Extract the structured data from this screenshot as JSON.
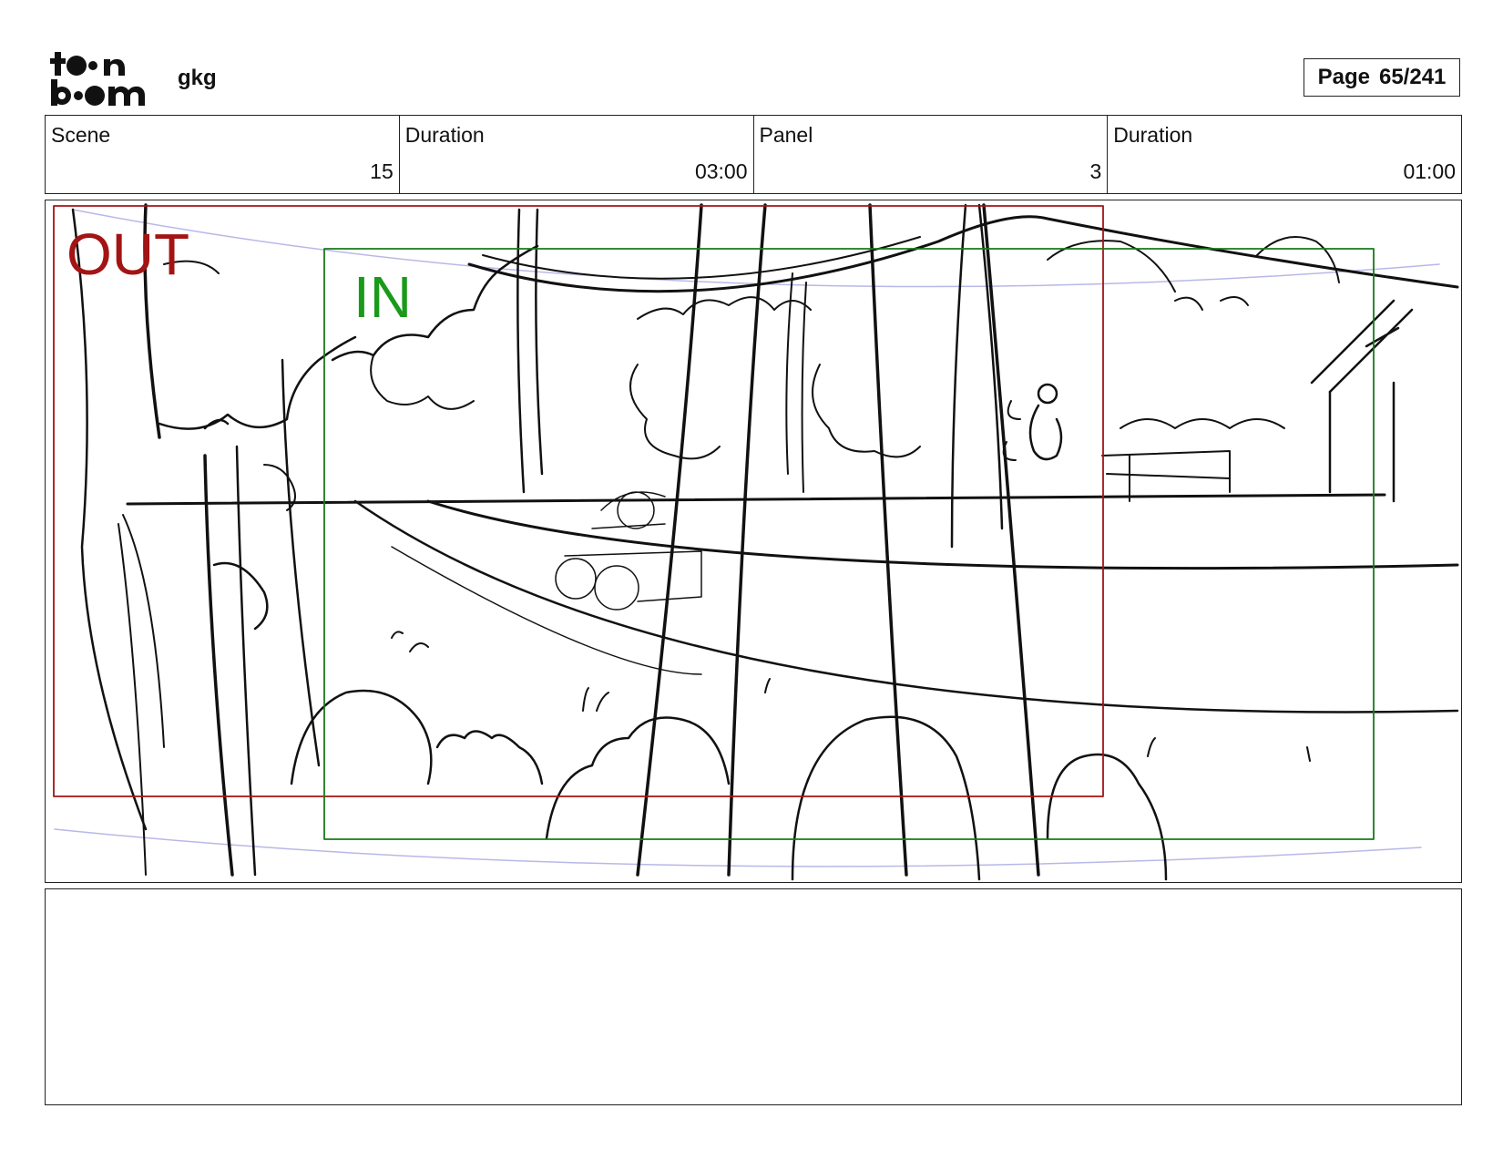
{
  "header": {
    "logo_text_top": "toon",
    "logo_text_bottom": "boom",
    "project_name": "gkg",
    "page_label": "Page",
    "page_value": "65/241"
  },
  "info": {
    "scene_label": "Scene",
    "scene_value": "15",
    "scene_duration_label": "Duration",
    "scene_duration_value": "03:00",
    "panel_label": "Panel",
    "panel_value": "3",
    "panel_duration_label": "Duration",
    "panel_duration_value": "01:00"
  },
  "panel": {
    "out_label": "OUT",
    "in_label": "IN",
    "out_frame_color": "#a31414",
    "in_frame_color": "#1a7a1a",
    "guide_color": "#b8b8e8"
  },
  "notes": {
    "text": ""
  }
}
